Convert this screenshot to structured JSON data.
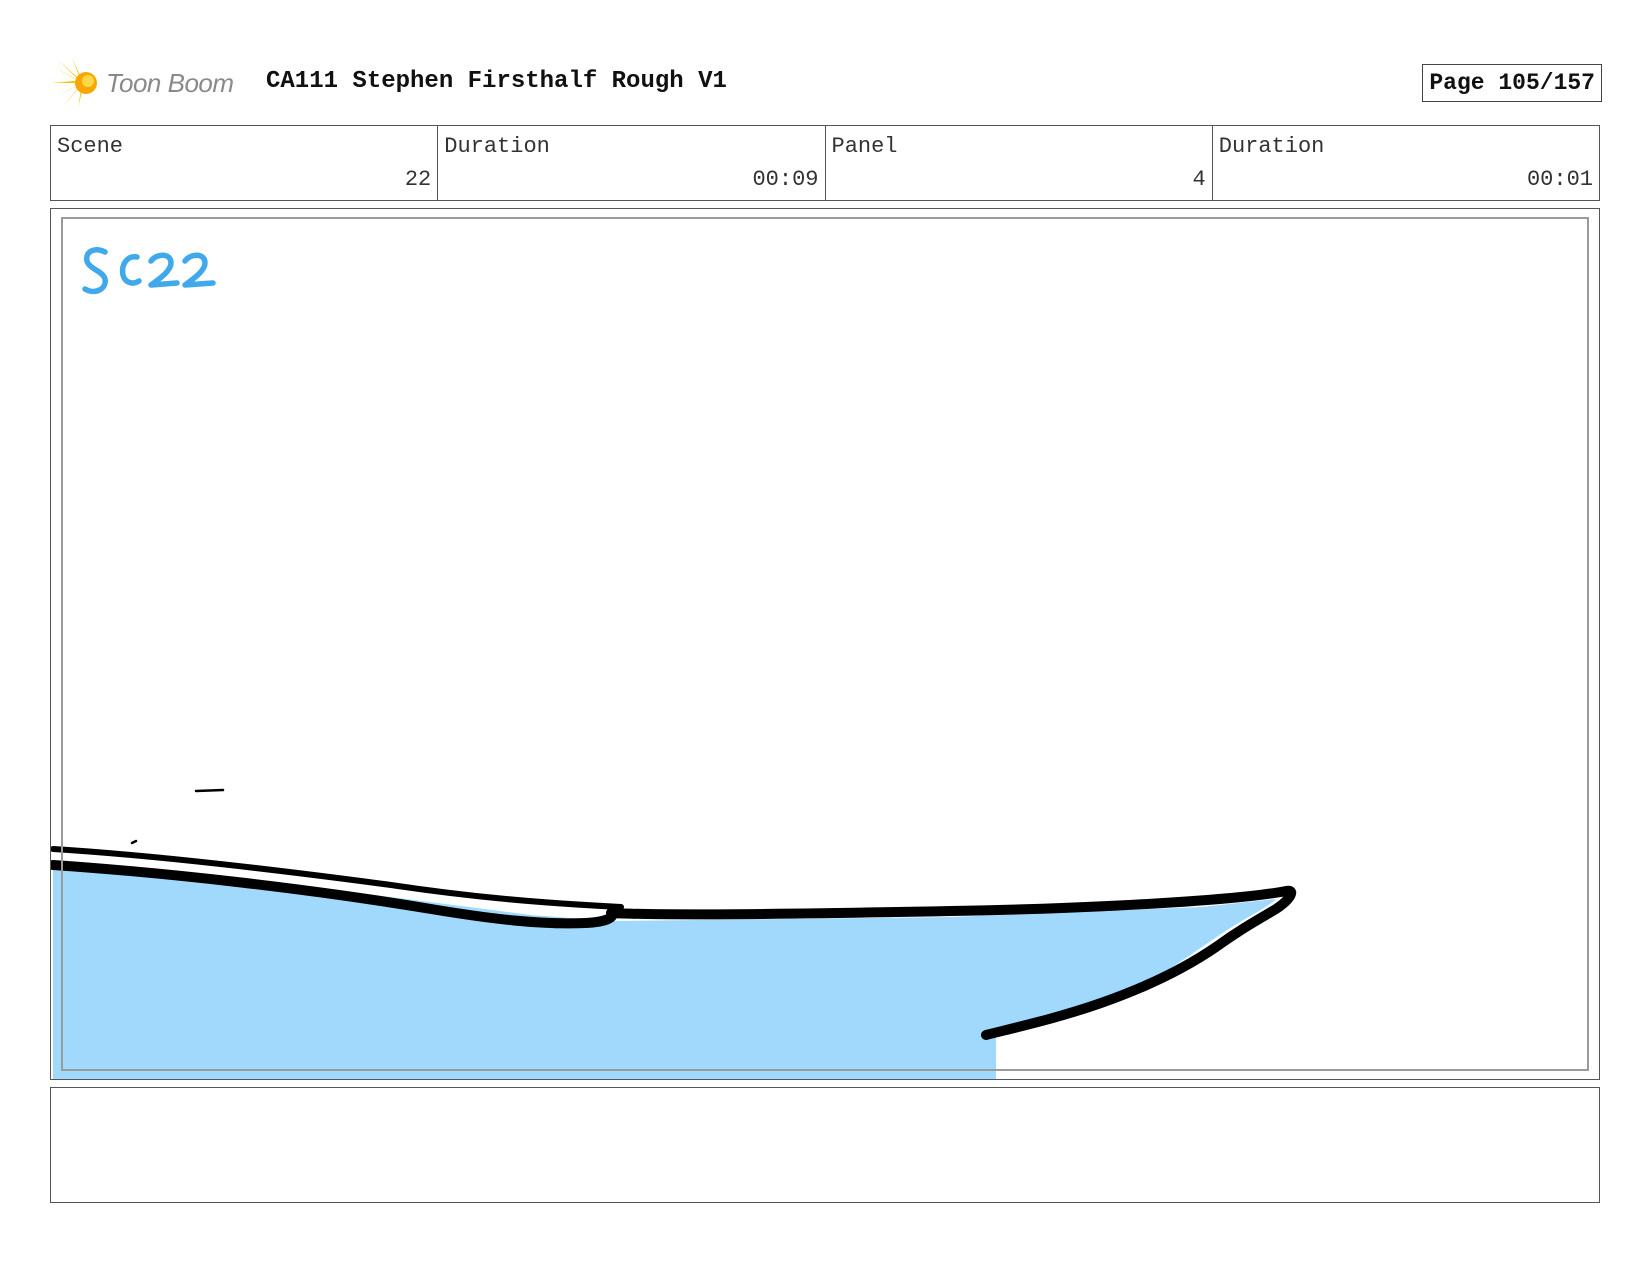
{
  "header": {
    "logo_text": "Toon Boom",
    "title": "CA111 Stephen Firsthalf Rough V1",
    "page": "Page 105/157"
  },
  "info": {
    "scene_label": "Scene",
    "scene_value": "22",
    "scene_duration_label": "Duration",
    "scene_duration_value": "00:09",
    "panel_label": "Panel",
    "panel_value": "4",
    "panel_duration_label": "Duration",
    "panel_duration_value": "00:01"
  },
  "panel": {
    "sketch_label": "SC22",
    "colors": {
      "water": "#a0d9fb",
      "ink": "#000000",
      "label_ink": "#3fa9ec",
      "logo_yellow": "#f5c400"
    }
  },
  "notes": {
    "text": ""
  }
}
